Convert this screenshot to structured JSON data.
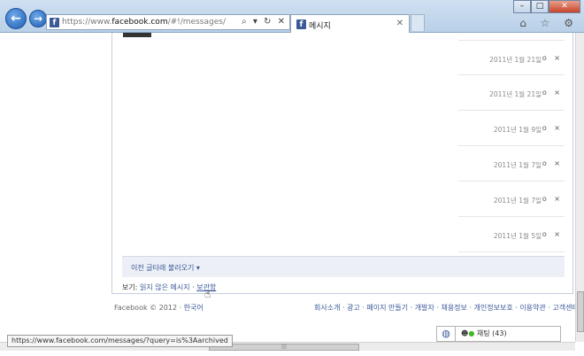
{
  "browser": {
    "url_prefix": "https://www.",
    "url_domain": "facebook.com",
    "url_path": "/#!/messages/",
    "address_icons": "⌕ ▾ ↻ ✕",
    "tab_title": "메시지",
    "window_min": "–",
    "window_max": "□",
    "window_close": "✕",
    "toolbar_icons": "⌂ ☆ ⚙"
  },
  "messages": [
    {
      "date": "2011년 1월 21일"
    },
    {
      "date": "2011년 1월 21일"
    },
    {
      "date": "2011년 1월 9일"
    },
    {
      "date": "2011년 1월 7일"
    },
    {
      "date": "2011년 1월 7일"
    },
    {
      "date": "2011년 1월 5일"
    }
  ],
  "message_actions": "o ×",
  "older_messages_label": "이전 글타래 불러오기 ▾",
  "view_filter": {
    "label": "보기: ",
    "unread": "읽지 않은 메시지",
    "sep": " · ",
    "archived": "보관함"
  },
  "footer": {
    "copyright": "Facebook © 2012 · ",
    "language": "한국어",
    "links": "회사소개 · 광고 · 페이지 만들기 · 개발자 · 채용정보 · 개인정보보호 · 이용약관 · 고객센터"
  },
  "status_url": "https://www.facebook.com/messages/?query=is%3Aarchived",
  "chat": {
    "label": "채팅 (43)"
  },
  "colors": {
    "link": "#3b5998",
    "online": "#42b72a"
  }
}
